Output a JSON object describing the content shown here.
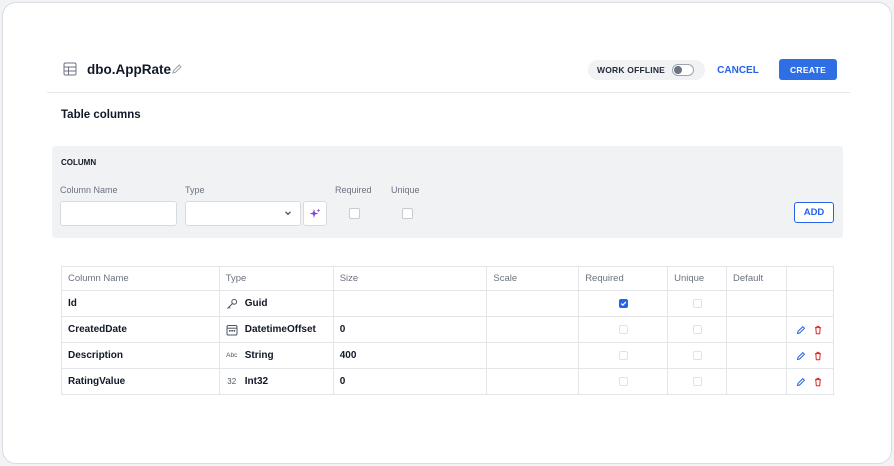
{
  "header": {
    "title": "dbo.AppRate",
    "work_offline_label": "WORK OFFLINE",
    "work_offline_on": false,
    "cancel_label": "CANCEL",
    "create_label": "CREATE",
    "accent_color": "#2f6fe4"
  },
  "section_title": "Table columns",
  "column_form": {
    "panel_title": "COLUMN",
    "name_label": "Column Name",
    "name_value": "",
    "type_label": "Type",
    "type_value": "",
    "required_label": "Required",
    "required_checked": false,
    "unique_label": "Unique",
    "unique_checked": false,
    "add_label": "ADD"
  },
  "columns_table": {
    "headers": [
      "Column Name",
      "Type",
      "Size",
      "Scale",
      "Required",
      "Unique",
      "Default"
    ],
    "rows": [
      {
        "name": "Id",
        "type_icon": "key-icon",
        "type": "Guid",
        "size": "",
        "scale": "",
        "required": true,
        "unique": false,
        "default": "",
        "actions": false
      },
      {
        "name": "CreatedDate",
        "type_icon": "calendar-icon",
        "type": "DatetimeOffset",
        "size": "0",
        "scale": "",
        "required": false,
        "unique": false,
        "default": "",
        "actions": true
      },
      {
        "name": "Description",
        "type_icon": "text-abc-icon",
        "type_icon_text": "Abc",
        "type": "String",
        "size": "400",
        "scale": "",
        "required": false,
        "unique": false,
        "default": "",
        "actions": true
      },
      {
        "name": "RatingValue",
        "type_icon": "number-icon",
        "type_icon_text": "32",
        "type": "Int32",
        "size": "0",
        "scale": "",
        "required": false,
        "unique": false,
        "default": "",
        "actions": true
      }
    ]
  },
  "colors": {
    "edit": "#2563eb",
    "delete": "#dc2626"
  }
}
